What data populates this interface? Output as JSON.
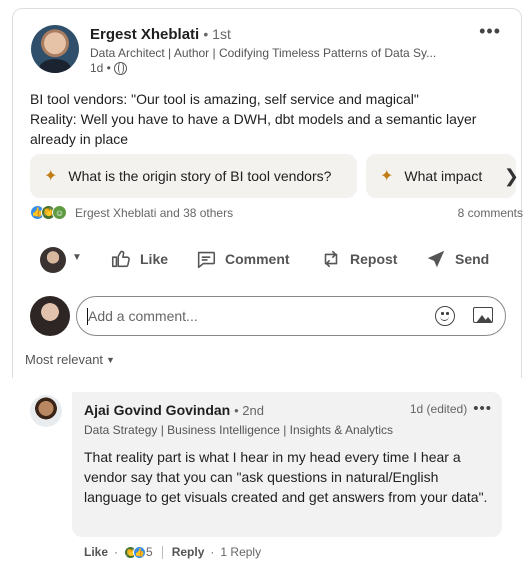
{
  "post": {
    "author_name": "Ergest Xheblati",
    "author_degree": "• 1st",
    "author_title": "Data Architect | Author | Codifying Timeless Patterns of Data Sy...",
    "time": "1d •",
    "more_label": "•••",
    "text_line1": "BI tool vendors: \"Our tool is amazing, self service and magical\"",
    "text_line2": "Reality: Well you have to have a DWH, dbt models and a semantic layer already in place"
  },
  "prompts": [
    {
      "spark": "✦",
      "label": "What is the origin story of BI tool vendors?"
    },
    {
      "spark": "✦",
      "label": "What impact"
    }
  ],
  "reactions": {
    "summary": "Ergest Xheblati and 38 others",
    "comments": "8 comments"
  },
  "actions": {
    "like": "Like",
    "comment": "Comment",
    "repost": "Repost",
    "send": "Send"
  },
  "comment_box": {
    "placeholder": "Add a comment..."
  },
  "sort": {
    "label": "Most relevant"
  },
  "comment": {
    "name": "Ajai Govind Govindan",
    "degree": "• 2nd",
    "time": "1d (edited)",
    "more_label": "•••",
    "headline": "Data Strategy | Business Intelligence | Insights & Analytics",
    "text": "That reality part is what I hear in my head every time I hear a vendor say that you can \"ask questions in natural/English language to get visuals created and get answers from your data\".",
    "like": "Like",
    "reaction_count": "5",
    "reply": "Reply",
    "replies": "1 Reply"
  },
  "colors": {
    "accent_spark": "#c37d16",
    "like_blue": "#378fe9",
    "celebrate_green": "#44712e",
    "bubble_bg": "#f2f2f2"
  }
}
